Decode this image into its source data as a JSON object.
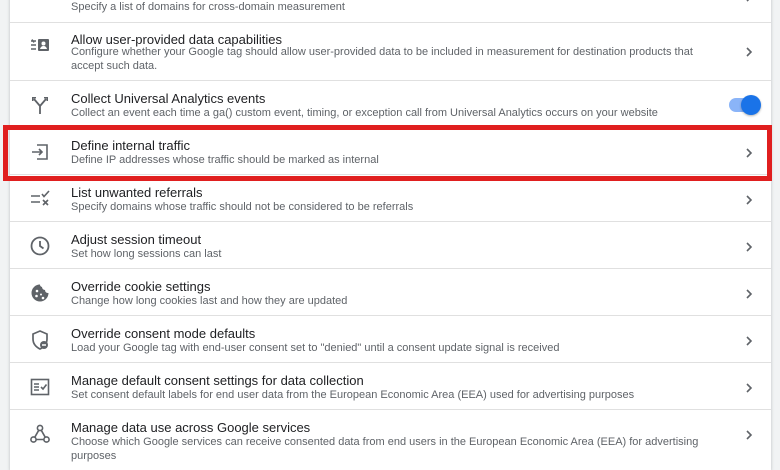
{
  "rows": [
    {
      "title": "",
      "desc": "Specify a list of domains for cross-domain measurement"
    },
    {
      "title": "Allow user-provided data capabilities",
      "desc": "Configure whether your Google tag should allow user-provided data to be included in measurement for destination products that accept such data."
    },
    {
      "title": "Collect Universal Analytics events",
      "desc": "Collect an event each time a ga() custom event, timing, or exception call from Universal Analytics occurs on your website"
    },
    {
      "title": "Define internal traffic",
      "desc": "Define IP addresses whose traffic should be marked as internal"
    },
    {
      "title": "List unwanted referrals",
      "desc": "Specify domains whose traffic should not be considered to be referrals"
    },
    {
      "title": "Adjust session timeout",
      "desc": "Set how long sessions can last"
    },
    {
      "title": "Override cookie settings",
      "desc": "Change how long cookies last and how they are updated"
    },
    {
      "title": "Override consent mode defaults",
      "desc": "Load your Google tag with end-user consent set to \"denied\" until a consent update signal is received"
    },
    {
      "title": "Manage default consent settings for data collection",
      "desc": "Set consent default labels for end user data from the European Economic Area (EEA) used for advertising purposes"
    },
    {
      "title": "Manage data use across Google services",
      "desc": "Choose which Google services can receive consented data from end users in the European Economic Area (EEA) for advertising purposes"
    }
  ],
  "icons": {
    "row1": "user-provided-data-icon",
    "row2": "merge-arrows-icon",
    "row3": "login-arrow-icon",
    "row4": "list-unwanted-icon",
    "row5": "clock-icon",
    "row6": "cookie-icon",
    "row7": "consent-shield-icon",
    "row8": "checklist-icon",
    "row9": "share-nodes-icon"
  },
  "toggle": {
    "state": "on"
  },
  "colors": {
    "accent": "#1a73e8",
    "toggle_track": "#8ab4f8",
    "highlight": "#e01f1f",
    "text_primary": "#202124",
    "text_secondary": "#5f6368",
    "divider": "#e0e0e0"
  }
}
